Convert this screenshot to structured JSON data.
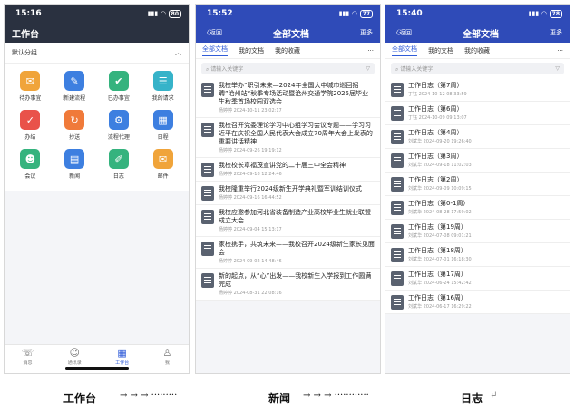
{
  "phone1": {
    "time": "15:16",
    "battery": "80",
    "header_title": "工作台",
    "group_label": "默认分组",
    "apps": [
      {
        "label": "待办事宜",
        "icon": "todo-icon",
        "glyph": "✉",
        "color": "#f0a43a"
      },
      {
        "label": "新建流程",
        "icon": "new-flow-icon",
        "glyph": "✎",
        "color": "#3d7fe0"
      },
      {
        "label": "已办事宜",
        "icon": "done-icon",
        "glyph": "✔",
        "color": "#35b37e"
      },
      {
        "label": "我的请求",
        "icon": "request-icon",
        "glyph": "☰",
        "color": "#36b3c9"
      },
      {
        "label": "办结",
        "icon": "finished-icon",
        "glyph": "✓",
        "color": "#e9524a"
      },
      {
        "label": "抄送",
        "icon": "cc-icon",
        "glyph": "↻",
        "color": "#f07a3a"
      },
      {
        "label": "流程代理",
        "icon": "proxy-icon",
        "glyph": "⚙",
        "color": "#3d7fe0"
      },
      {
        "label": "日程",
        "icon": "calendar-icon",
        "glyph": "▦",
        "color": "#3d7fe0"
      },
      {
        "label": "会议",
        "icon": "meeting-icon",
        "glyph": "☻",
        "color": "#35b37e"
      },
      {
        "label": "新闻",
        "icon": "news-icon",
        "glyph": "▤",
        "color": "#3d7fe0"
      },
      {
        "label": "日志",
        "icon": "log-icon",
        "glyph": "✐",
        "color": "#35b37e"
      },
      {
        "label": "邮件",
        "icon": "mail-icon",
        "glyph": "✉",
        "color": "#f0a43a"
      }
    ],
    "tabs": [
      {
        "label": "消息",
        "icon": "message-icon",
        "glyph": "☏"
      },
      {
        "label": "通讯录",
        "icon": "contacts-icon",
        "glyph": "☺"
      },
      {
        "label": "工作台",
        "icon": "workbench-icon",
        "glyph": "▦"
      },
      {
        "label": "我",
        "icon": "profile-icon",
        "glyph": "♙"
      }
    ]
  },
  "phone2": {
    "time": "15:52",
    "battery": "77",
    "back": "返回",
    "title": "全部文档",
    "more": "更多",
    "tabs": [
      "全部文档",
      "我的文档",
      "我的收藏"
    ],
    "search_placeholder": "请输入关键字",
    "items": [
      {
        "title": "我校举办“职引未来—2024年全国大中城市巡回招聘”沧州站“秋季专场活动暨沧州交通学院2025届毕业生秋季首场校园双选会",
        "meta": "杨婷婷 2024-10-11 23:02:17"
      },
      {
        "title": "我校召开党委理论学习中心组学习会议专题——学习习近平在庆祝全国人民代表大会成立70周年大会上发表的重要讲话精神",
        "meta": "杨婷婷 2024-09-26 19:19:12"
      },
      {
        "title": "我校校长章福茂宣讲党的二十届三中全会精神",
        "meta": "杨婷婷 2024-09-18 12:24:46"
      },
      {
        "title": "我校隆重举行2024级新生开学典礼暨军训结训仪式",
        "meta": "杨婷婷 2024-09-16 16:44:52"
      },
      {
        "title": "我校应邀参加河北省装备制造产业高校毕业生就业联盟成立大会",
        "meta": "杨婷婷 2024-09-04 15:13:17"
      },
      {
        "title": "家校携手，共筑未来——我校召开2024级新生家长见面会",
        "meta": "杨婷婷 2024-09-02 14:48:46"
      },
      {
        "title": "新的起点，从“心”出发——我校新生入学报到工作圆满完成",
        "meta": "杨婷婷 2024-08-31 22:08:16"
      }
    ]
  },
  "phone3": {
    "time": "15:40",
    "battery": "78",
    "back": "返回",
    "title": "全部文档",
    "more": "更多",
    "tabs": [
      "全部文档",
      "我的文档",
      "我的收藏"
    ],
    "search_placeholder": "请输入关键字",
    "items": [
      {
        "title": "工作日志（第7周）",
        "meta": "丁钰 2024-10-12 08:33:59"
      },
      {
        "title": "工作日志（第6周）",
        "meta": "丁钰 2024-10-09 09:13:07"
      },
      {
        "title": "工作日志（第4周）",
        "meta": "刘斌华 2024-09-20 19:26:40"
      },
      {
        "title": "工作日志（第3周）",
        "meta": "刘斌华 2024-09-18 11:02:03"
      },
      {
        "title": "工作日志（第2周）",
        "meta": "刘斌华 2024-09-09 10:09:15"
      },
      {
        "title": "工作日志（第0-1周）",
        "meta": "刘斌华 2024-08-28 17:59:02"
      },
      {
        "title": "工作日志（第19周）",
        "meta": "刘斌华 2024-07-08 09:01:21"
      },
      {
        "title": "工作日志（第18周）",
        "meta": "刘斌华 2024-07-01 16:18:30"
      },
      {
        "title": "工作日志（第17周）",
        "meta": "刘斌华 2024-06-24 15:42:42"
      },
      {
        "title": "工作日志（第16周）",
        "meta": "刘斌华 2024-06-17 16:29:22"
      }
    ]
  },
  "caption": {
    "part1": "工作台",
    "arrows1": "→ → → ·········",
    "part2": "新闻",
    "arrows2": "→ → → ············",
    "part3": "日志",
    "end": "↵"
  }
}
